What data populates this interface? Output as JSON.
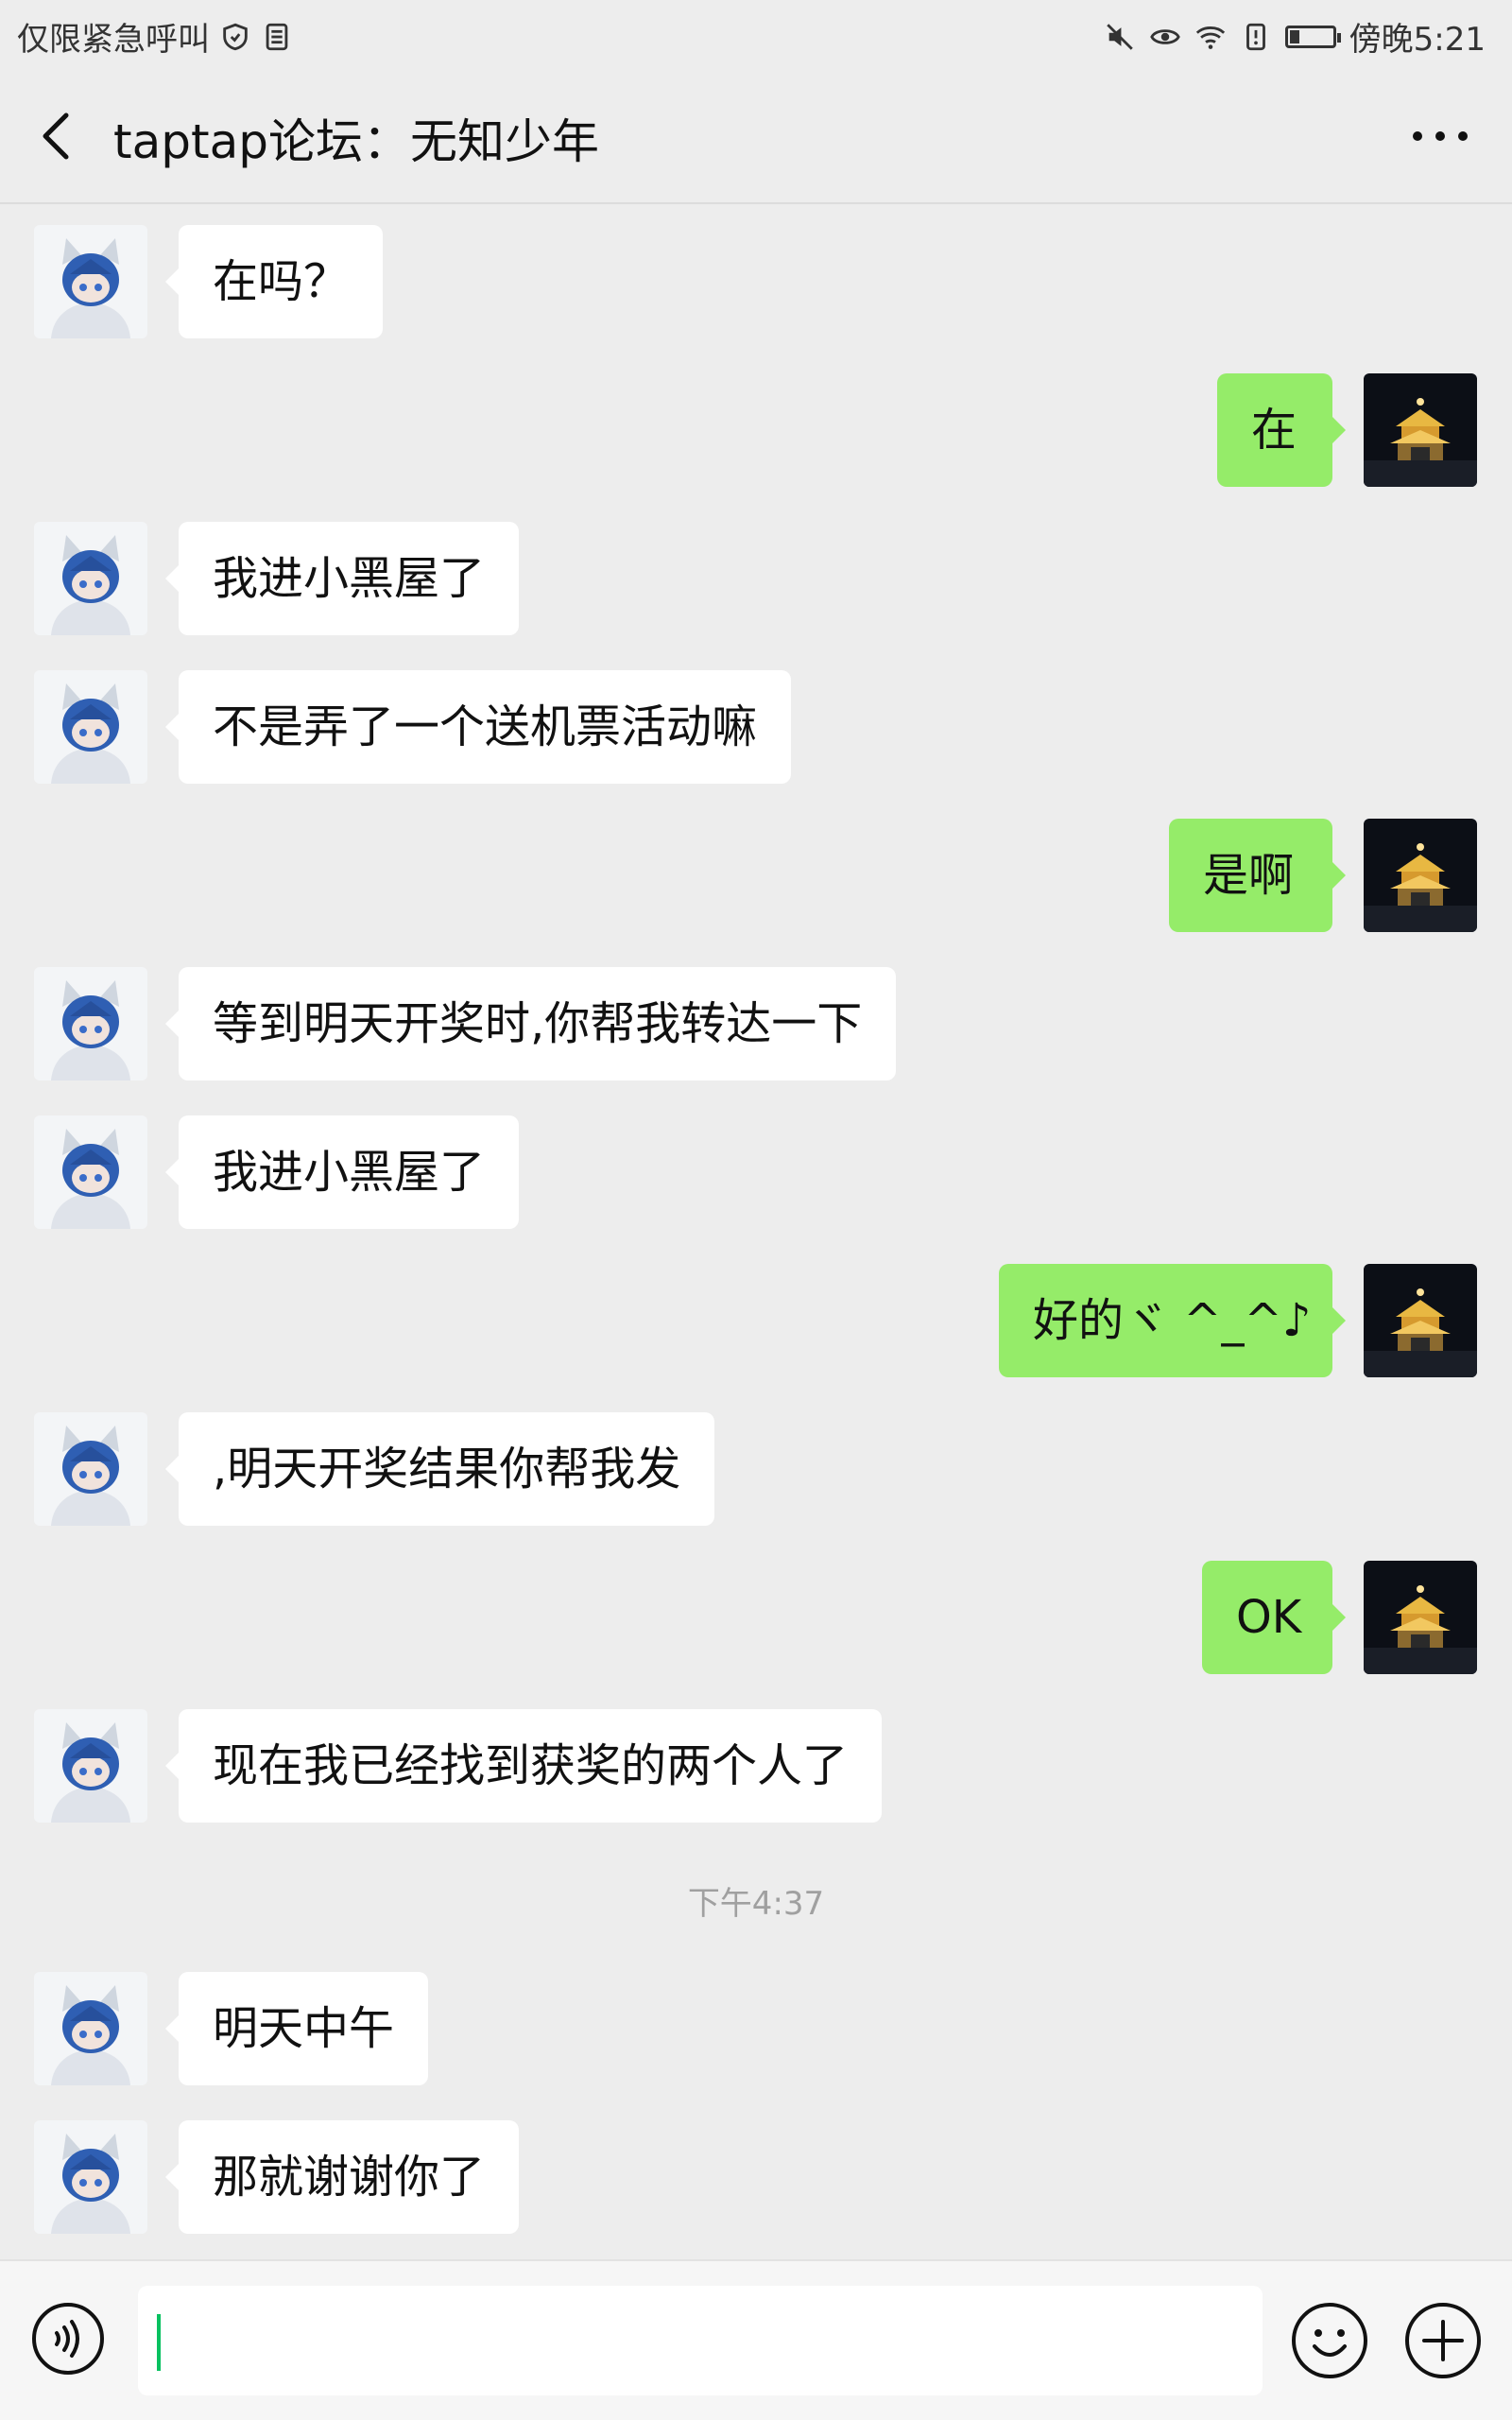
{
  "status_bar": {
    "left_text": "仅限紧急呼叫",
    "time_text": "傍晚5:21",
    "icons": [
      "shield-icon",
      "sim-card-icon",
      "mute-icon",
      "eye-icon",
      "wifi-icon",
      "alert-icon",
      "battery-icon"
    ]
  },
  "header": {
    "title": "taptap论坛：无知少年",
    "back_icon": "chevron-left-icon",
    "more_icon": "more-dots-icon"
  },
  "messages": [
    {
      "side": "left",
      "text": "在吗？"
    },
    {
      "side": "right",
      "text": "在"
    },
    {
      "side": "left",
      "text": "我进小黑屋了"
    },
    {
      "side": "left",
      "text": "不是弄了一个送机票活动嘛"
    },
    {
      "side": "right",
      "text": "是啊"
    },
    {
      "side": "left",
      "text": "等到明天开奖时,你帮我转达一下"
    },
    {
      "side": "left",
      "text": "我进小黑屋了"
    },
    {
      "side": "right",
      "text": "好的ヾ ^_^♪"
    },
    {
      "side": "left",
      "text": ",明天开奖结果你帮我发"
    },
    {
      "side": "right",
      "text": "OK"
    },
    {
      "side": "left",
      "text": "现在我已经找到获奖的两个人了"
    },
    {
      "side": "left",
      "text": "明天中午"
    },
    {
      "side": "left",
      "text": "那就谢谢你了"
    }
  ],
  "time_divider": "下午4:37",
  "input_bar": {
    "value": "",
    "voice_icon": "voice-icon",
    "emoji_icon": "emoji-icon",
    "plus_icon": "plus-icon"
  },
  "colors": {
    "background": "#ededed",
    "bubble_left": "#ffffff",
    "bubble_right": "#95ec69",
    "caret": "#07c160"
  }
}
